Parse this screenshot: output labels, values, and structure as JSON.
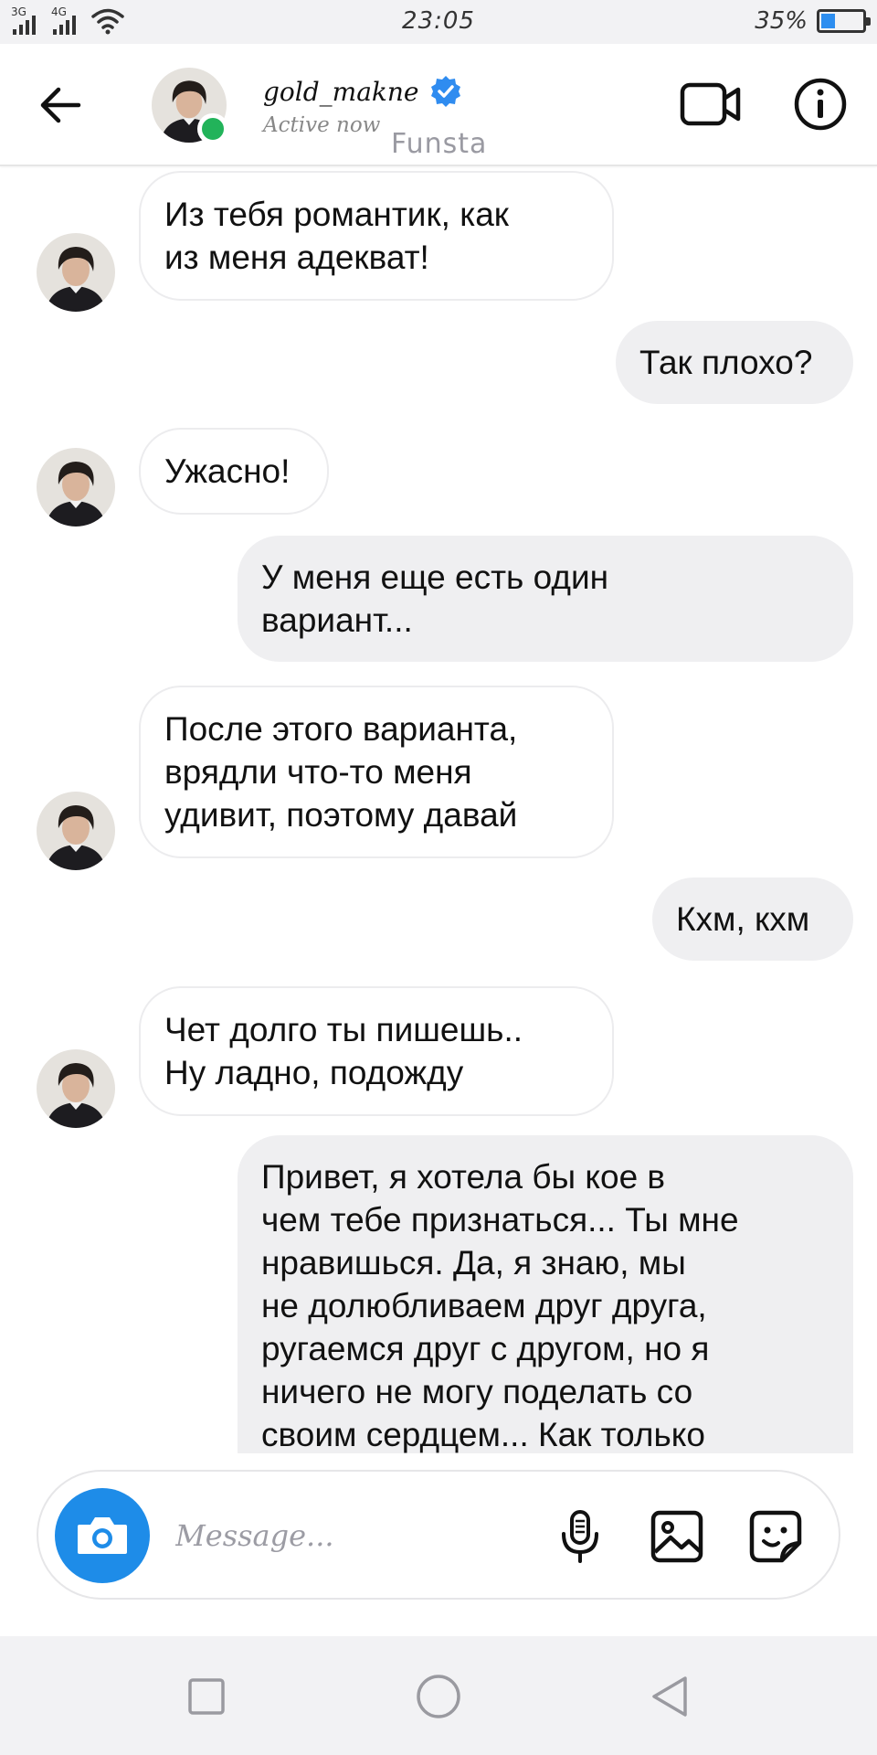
{
  "status_bar": {
    "network_1": "3G",
    "network_2": "4G",
    "time": "23:05",
    "battery_text": "35%",
    "battery_level": 0.35
  },
  "header": {
    "username": "gold_makne",
    "presence": "Active now",
    "watermark": "Funsta",
    "verified": true,
    "icons": [
      "back-arrow-icon",
      "avatar",
      "online-dot",
      "verified-badge-icon",
      "video-call-icon",
      "info-icon"
    ]
  },
  "messages": [
    {
      "from": "them",
      "text": "Из тебя романтик, как\nиз меня адекват!"
    },
    {
      "from": "me",
      "text": "Так плохо?"
    },
    {
      "from": "them",
      "text": "Ужасно!"
    },
    {
      "from": "me",
      "text": "У меня еще есть один\nвариант..."
    },
    {
      "from": "them",
      "text": "После этого варианта,\nврядли что-то меня\nудивит, поэтому давай"
    },
    {
      "from": "me",
      "text": "Кхм, кхм"
    },
    {
      "from": "them",
      "text": "Чет долго ты пишешь..\nНу ладно, подожду"
    },
    {
      "from": "me",
      "text": "Привет, я хотела бы кое в\nчем тебе признаться... Ты мне\nнравишься. Да, я знаю, мы\nне долюбливаем друг друга,\nругаемся друг с другом, но я\nничего не могу поделать со\nсвоим сердцем... Как только"
    }
  ],
  "composer": {
    "placeholder": "Message...",
    "icons": [
      "camera-icon",
      "microphone-icon",
      "gallery-icon",
      "sticker-icon"
    ]
  },
  "nav_bar": {
    "icons": [
      "recents-square-icon",
      "home-circle-icon",
      "back-triangle-icon"
    ]
  },
  "colors": {
    "accent_blue": "#1e8ce8",
    "online_green": "#22b35a",
    "outgoing_bubble": "#efeff1",
    "incoming_border": "#ececee"
  }
}
